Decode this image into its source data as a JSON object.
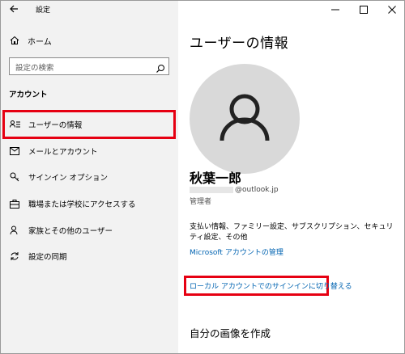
{
  "app": {
    "title": "設定"
  },
  "sidebar": {
    "home_label": "ホーム",
    "search_placeholder": "設定の検索",
    "section_label": "アカウント",
    "items": [
      {
        "label": "ユーザーの情報",
        "icon": "user-info-icon",
        "selected": true
      },
      {
        "label": "メールとアカウント",
        "icon": "mail-icon"
      },
      {
        "label": "サインイン オプション",
        "icon": "key-icon"
      },
      {
        "label": "職場または学校にアクセスする",
        "icon": "briefcase-icon"
      },
      {
        "label": "家族とその他のユーザー",
        "icon": "add-user-icon"
      },
      {
        "label": "設定の同期",
        "icon": "sync-icon"
      }
    ]
  },
  "main": {
    "title": "ユーザーの情報",
    "user_name": "秋葉一郎",
    "email_domain": "@outlook.jp",
    "role": "管理者",
    "description": "支払い情報、ファミリー設定、サブスクリプション、セキュリティ設定、その他",
    "ms_account_link": "Microsoft アカウントの管理",
    "switch_local_link": "ローカル アカウントでのサインインに切り替える",
    "create_picture_heading": "自分の画像を作成"
  },
  "colors": {
    "highlight": "#e60012",
    "link": "#0063b1",
    "sidebar_bg": "#f2f2f2",
    "avatar_bg": "#d9d9d9"
  }
}
